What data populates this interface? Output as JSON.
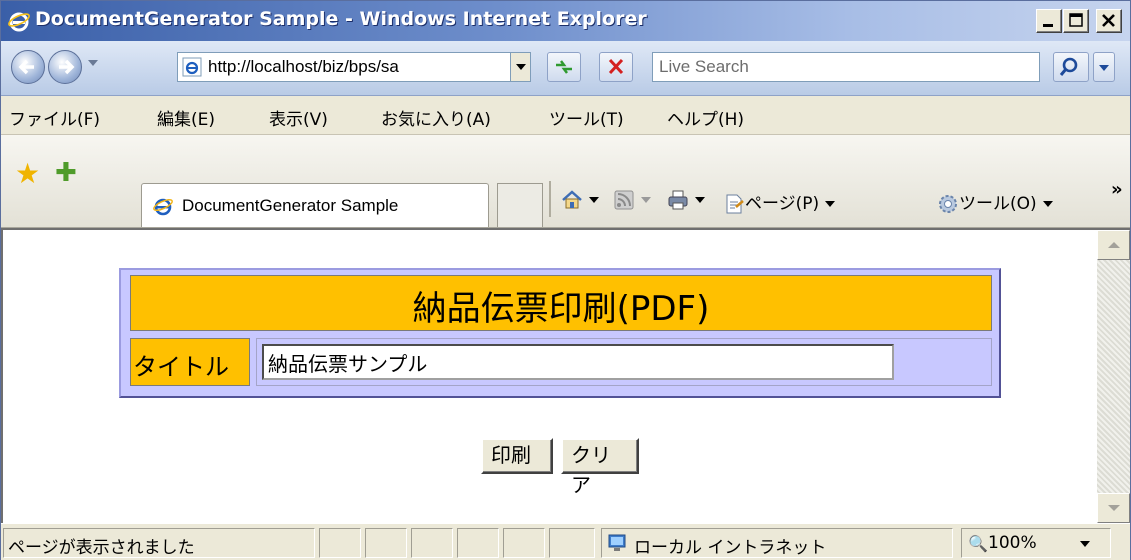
{
  "window": {
    "title": "DocumentGenerator Sample - Windows Internet Explorer"
  },
  "addressbar": {
    "url": "http://localhost/biz/bps/sa",
    "search_placeholder": "Live Search"
  },
  "menu": {
    "items": [
      "ファイル(F)",
      "編集(E)",
      "表示(V)",
      "お気に入り(A)",
      "ツール(T)",
      "ヘルプ(H)"
    ]
  },
  "toolbar": {
    "tab_label": "DocumentGenerator Sample",
    "page_label": "ページ(P)",
    "tools_label": "ツール(O)",
    "chevrons": "»"
  },
  "form": {
    "heading": "納品伝票印刷(PDF)",
    "title_label": "タイトル",
    "title_value": "納品伝票サンプル",
    "print_button": "印刷",
    "clear_button": "クリア"
  },
  "status": {
    "text": "ページが表示されました",
    "zone": "ローカル イントラネット",
    "zoom": "100%"
  },
  "colors": {
    "header_bg": "#ffc000",
    "form_bg": "#c8c8ff"
  }
}
